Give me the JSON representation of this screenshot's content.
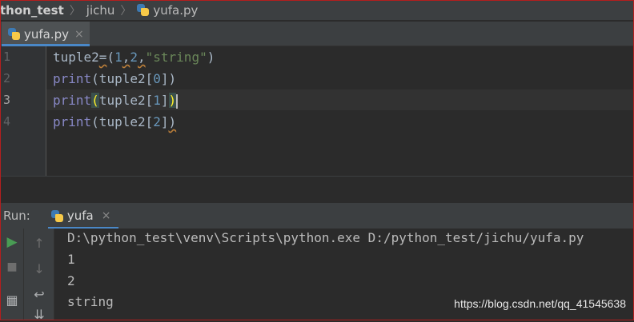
{
  "breadcrumb": {
    "items": [
      "thon_test",
      "jichu",
      "yufa.py"
    ],
    "separator": "〉"
  },
  "editor_tab": {
    "label": "yufa.py",
    "close": "×"
  },
  "editor": {
    "line_numbers": [
      "1",
      "2",
      "3",
      "4"
    ],
    "lines": [
      {
        "parts": [
          {
            "t": "tuple2",
            "c": ""
          },
          {
            "t": "=",
            "c": "squig"
          },
          {
            "t": "(",
            "c": ""
          },
          {
            "t": "1",
            "c": "num"
          },
          {
            "t": ",",
            "c": "squig"
          },
          {
            "t": "2",
            "c": "num"
          },
          {
            "t": ",",
            "c": "squig"
          },
          {
            "t": "\"string\"",
            "c": "str"
          },
          {
            "t": ")",
            "c": ""
          }
        ]
      },
      {
        "parts": [
          {
            "t": "print",
            "c": "kw"
          },
          {
            "t": "(tuple2[",
            "c": ""
          },
          {
            "t": "0",
            "c": "num"
          },
          {
            "t": "])",
            "c": ""
          }
        ]
      },
      {
        "parts": [
          {
            "t": "print",
            "c": "kw"
          },
          {
            "t": "(",
            "c": "brace-hl"
          },
          {
            "t": "tuple2[",
            "c": ""
          },
          {
            "t": "1",
            "c": "num"
          },
          {
            "t": "]",
            "c": ""
          },
          {
            "t": ")",
            "c": "brace-hl"
          }
        ]
      },
      {
        "parts": [
          {
            "t": "print",
            "c": "kw"
          },
          {
            "t": "(tuple2[",
            "c": ""
          },
          {
            "t": "2",
            "c": "num"
          },
          {
            "t": "]",
            "c": ""
          },
          {
            "t": ")",
            "c": "squig"
          }
        ]
      }
    ]
  },
  "run_panel": {
    "label": "Run:",
    "tab_label": "yufa",
    "tab_close": "×",
    "icons": {
      "run": "▶",
      "stop": "■",
      "layout": "▦",
      "print": "⎙",
      "up": "↑",
      "down": "↓",
      "wrap": "↩",
      "scroll_end": "⇊"
    }
  },
  "console": {
    "lines": [
      "D:\\python_test\\venv\\Scripts\\python.exe D:/python_test/jichu/yufa.py",
      "1",
      "2",
      "string"
    ]
  },
  "watermark": "https://blog.csdn.net/qq_41545638",
  "colors": {
    "background": "#2b2b2b",
    "panel": "#3c3f41",
    "keyword": "#8888c6",
    "number": "#6897bb",
    "string": "#6a8759",
    "accent": "#4a88c7",
    "run_green": "#499c54"
  }
}
